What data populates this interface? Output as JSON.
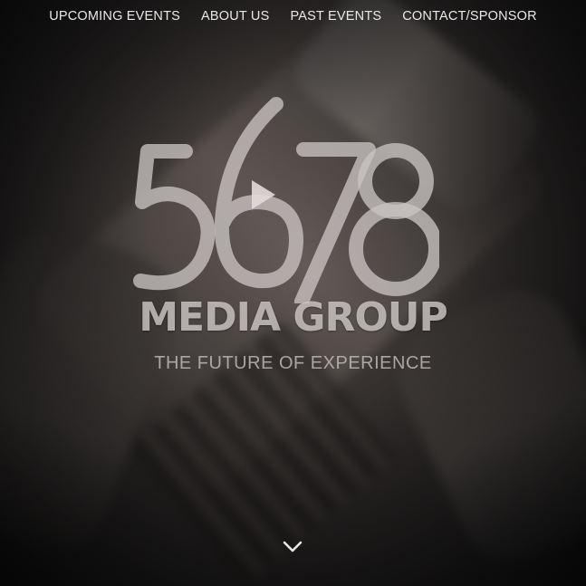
{
  "nav": {
    "items": [
      {
        "label": "UPCOMING EVENTS"
      },
      {
        "label": "ABOUT US"
      },
      {
        "label": "PAST EVENTS"
      },
      {
        "label": "CONTACT/SPONSOR"
      }
    ]
  },
  "logo": {
    "numerals": "5678",
    "brand": "MEDIA GROUP",
    "tagline": "THE FUTURE OF EXPERIENCE",
    "play_icon": "play-icon"
  },
  "scroll": {
    "icon": "chevron-down-icon"
  },
  "colors": {
    "nav_text": "#e9e9e9",
    "logo_text": "#d7d2d0",
    "background": "#2a2625"
  }
}
